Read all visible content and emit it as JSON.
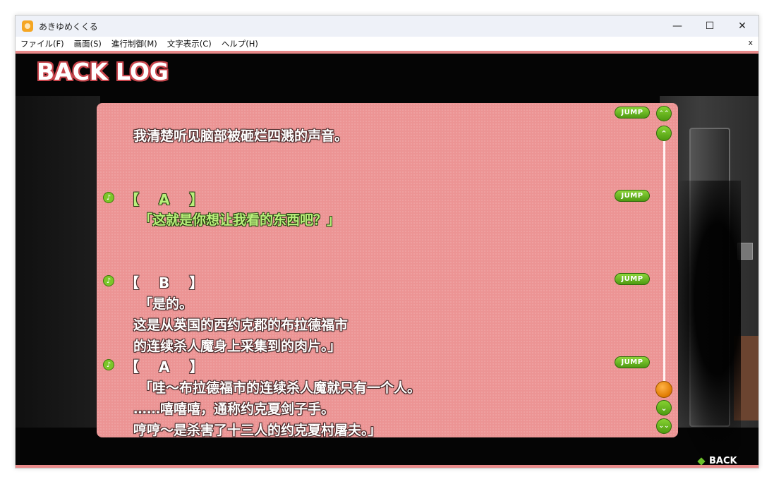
{
  "window": {
    "title": "あきゆめくくる",
    "minimize": "—",
    "maximize": "☐",
    "close": "✕"
  },
  "menu": {
    "items": [
      "ファイル(F)",
      "画面(S)",
      "進行制御(M)",
      "文字表示(C)",
      "ヘルプ(H)"
    ],
    "close": "x"
  },
  "backlog": {
    "title": "BACK LOG",
    "jump_label": "JUMP",
    "back_label": "BACK",
    "entries": [
      {
        "speaker": "",
        "lines": [
          "我清楚听见脑部被砸烂四溅的声音。"
        ]
      },
      {
        "speaker": "【　A　】",
        "lines": [
          "「这就是你想让我看的东西吧？」"
        ]
      },
      {
        "speaker": "【　B　】",
        "lines": [
          "「是的。",
          "这是从英国的西约克郡的布拉德福市",
          "的连续杀人魔身上采集到的肉片。」"
        ]
      },
      {
        "speaker": "【　A　】",
        "lines": [
          "「哇～布拉德福市的连续杀人魔就只有一个人。",
          "……嘻嘻嘻，通称约克夏剑子手。",
          "哼哼～是杀害了十三人的约克夏村屠夫。」"
        ]
      }
    ]
  },
  "scrollbar": {
    "top_label": "⌃⌃",
    "up_label": "⌃",
    "down_label": "⌄",
    "bottom_label": "⌄⌄"
  },
  "colors": {
    "panel": "#ec9494",
    "accent_green": "#6cc22a",
    "thumb_orange": "#e07a00"
  }
}
